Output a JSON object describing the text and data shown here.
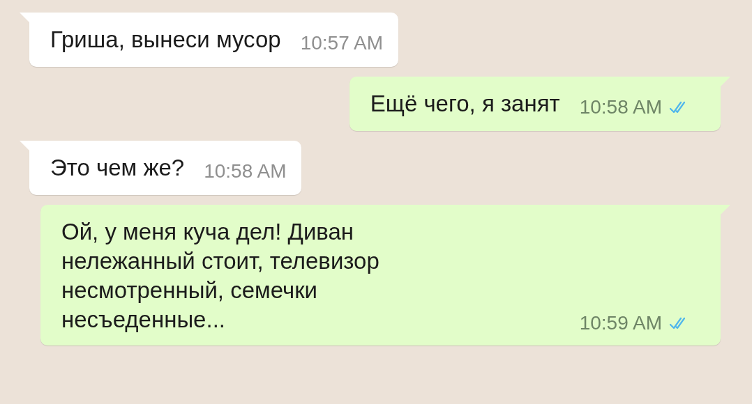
{
  "messages": [
    {
      "kind": "received",
      "text": "Гриша, вынеси мусор",
      "time": "10:57 AM"
    },
    {
      "kind": "sent",
      "text": "Ещё чего, я занят",
      "time": "10:58 AM",
      "read": true
    },
    {
      "kind": "received",
      "text": "Это чем же?",
      "time": "10:58 AM"
    },
    {
      "kind": "sent",
      "text": "Ой, у меня куча дел! Диван нележанный стоит, телевизор несмотренный, семечки несъеденные...",
      "time": "10:59 AM",
      "read": true
    }
  ]
}
